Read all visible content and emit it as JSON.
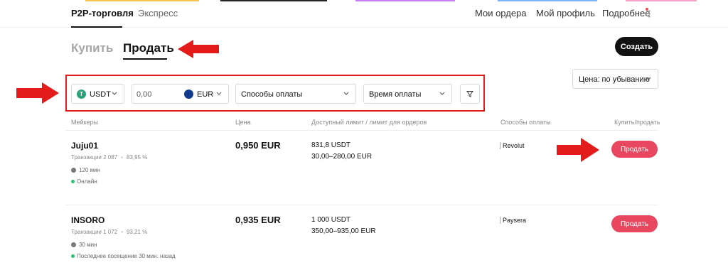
{
  "colors": {
    "accent_sell": "#e8475f",
    "primary_dark": "#121212",
    "annotation_red": "#e31b1b",
    "online_green": "#2ebf6f"
  },
  "topnav": {
    "tabs": [
      "P2P-торговля",
      "Экспресс"
    ],
    "links": {
      "orders": "Мои ордера",
      "profile": "Мой профиль",
      "more": "Подробнее"
    }
  },
  "trade_mode": {
    "buy": "Купить",
    "sell": "Продать",
    "active": "Продать"
  },
  "create_button": "Создать",
  "filters": {
    "coin": "USDT",
    "amount_placeholder": "0,00",
    "fiat": "EUR",
    "payment_methods": "Способы оплаты",
    "payment_time": "Время оплаты",
    "filter_icon": "funnel-icon"
  },
  "sort": "Цена: по убыванию",
  "table": {
    "headers": {
      "makers": "Мейкеры",
      "price": "Цена",
      "limit": "Доступный лимит / лимит для ордеров",
      "payment": "Способы оплаты",
      "action": "Купить/продать"
    },
    "rows": [
      {
        "name": "Juju01",
        "trades": "Транзакции 2 087",
        "completion": "83,95 %",
        "time": "120 мин",
        "status": "Онлайн",
        "price": "0,950 EUR",
        "available": "831,8 USDT",
        "limit": "30,00–280,00 EUR",
        "payment": "Revolut",
        "action": "Продать"
      },
      {
        "name": "INSORO",
        "trades": "Транзакции 1 072",
        "completion": "93,21 %",
        "time": "30 мин",
        "status": "Последнее посещение 30 мин. назад",
        "price": "0,935 EUR",
        "available": "1 000 USDT",
        "limit": "350,00–935,00 EUR",
        "payment": "Paysera",
        "action": "Продать"
      }
    ]
  }
}
